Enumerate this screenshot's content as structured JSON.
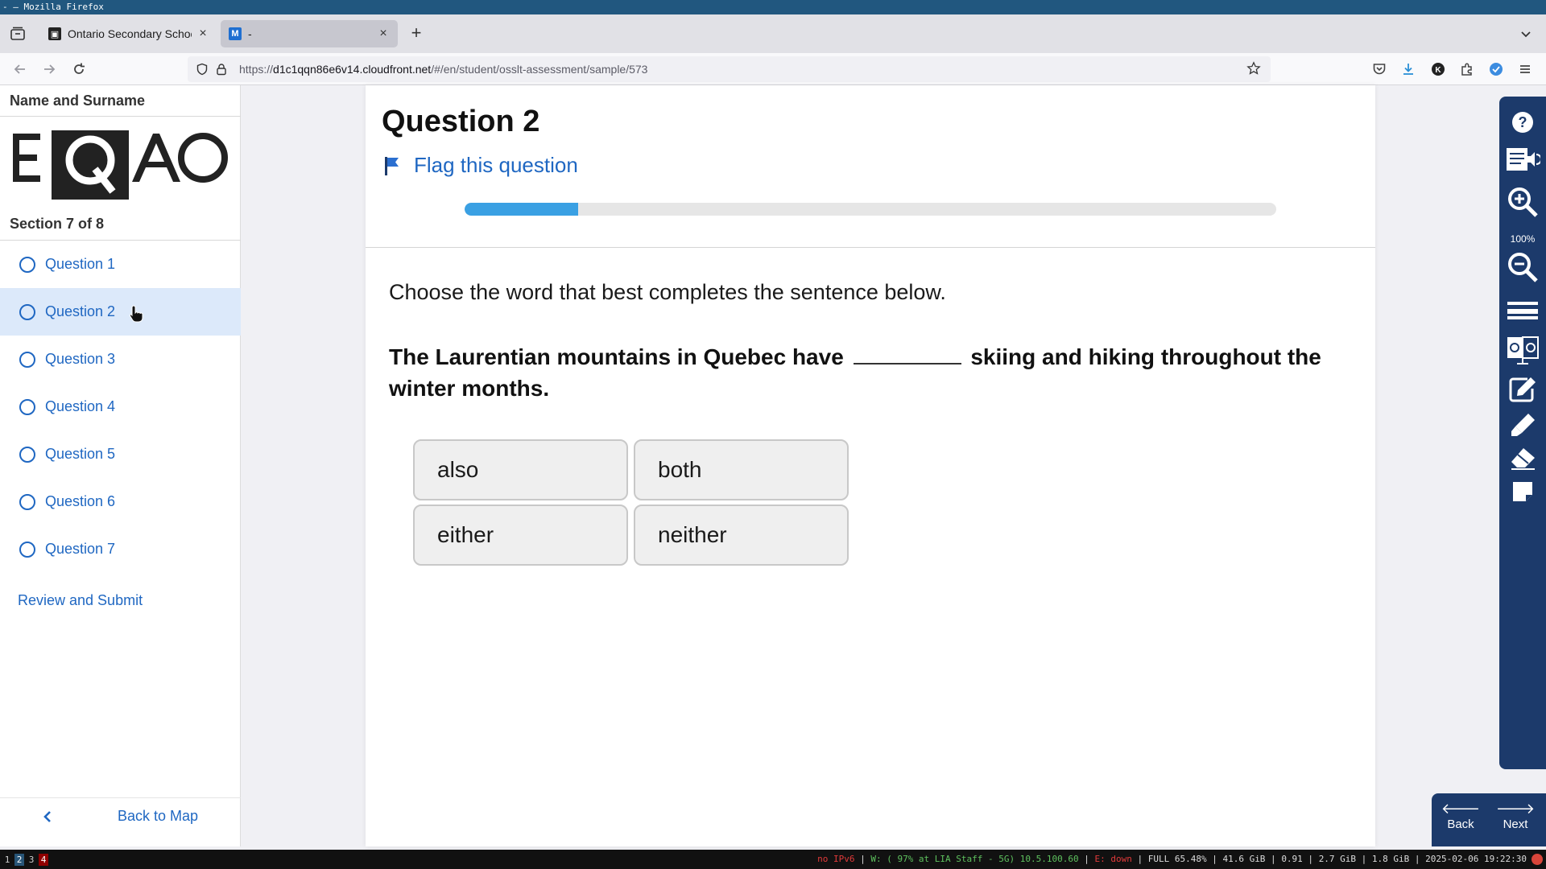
{
  "window": {
    "title": "- — Mozilla Firefox"
  },
  "browser": {
    "tabs": [
      {
        "title": "Ontario Secondary School",
        "active": false
      },
      {
        "title": "-",
        "active": true
      }
    ],
    "url_prefix": "https://",
    "url_domain": "d1c1qqn86e6v14.cloudfront.net",
    "url_path": "/#/en/student/osslt-assessment/sample/573"
  },
  "sidebar": {
    "student_name": "Name and Surname",
    "logo_text": "EQAO",
    "section": "Section 7 of 8",
    "questions": [
      {
        "label": "Question 1",
        "active": false
      },
      {
        "label": "Question 2",
        "active": true
      },
      {
        "label": "Question 3",
        "active": false
      },
      {
        "label": "Question 4",
        "active": false
      },
      {
        "label": "Question 5",
        "active": false
      },
      {
        "label": "Question 6",
        "active": false
      },
      {
        "label": "Question 7",
        "active": false
      }
    ],
    "review_submit": "Review and Submit",
    "back_to_map": "Back to Map"
  },
  "main": {
    "title": "Question 2",
    "flag_label": "Flag this question",
    "progress_fraction": 0.14,
    "prompt": "Choose the word that best completes the sentence below.",
    "stem_before": "The Laurentian mountains in Quebec have",
    "stem_after": "skiing and hiking throughout the winter months.",
    "options": [
      "also",
      "both",
      "either",
      "neither"
    ]
  },
  "tools": {
    "zoom_level": "100%"
  },
  "bottom_nav": {
    "back": "Back",
    "next": "Next"
  },
  "statusbar": {
    "workspaces": [
      "1",
      "2",
      "3",
      "4"
    ],
    "ipv6": "no IPv6",
    "wifi": "W: ( 97% at LIA Staff - 5G) 10.5.100.60",
    "eth": "E: down",
    "disk": "FULL 65.48%",
    "mem1": "41.6 GiB",
    "load": "0.91",
    "mem2": "2.7 GiB",
    "mem3": "1.8 GiB",
    "datetime": "2025-02-06 19:22:30"
  },
  "colors": {
    "accent_blue": "#1f67c2",
    "progress_fill": "#3aa0e3",
    "toolbar_navy": "#1c3a6b",
    "active_row": "#dce9fa"
  }
}
